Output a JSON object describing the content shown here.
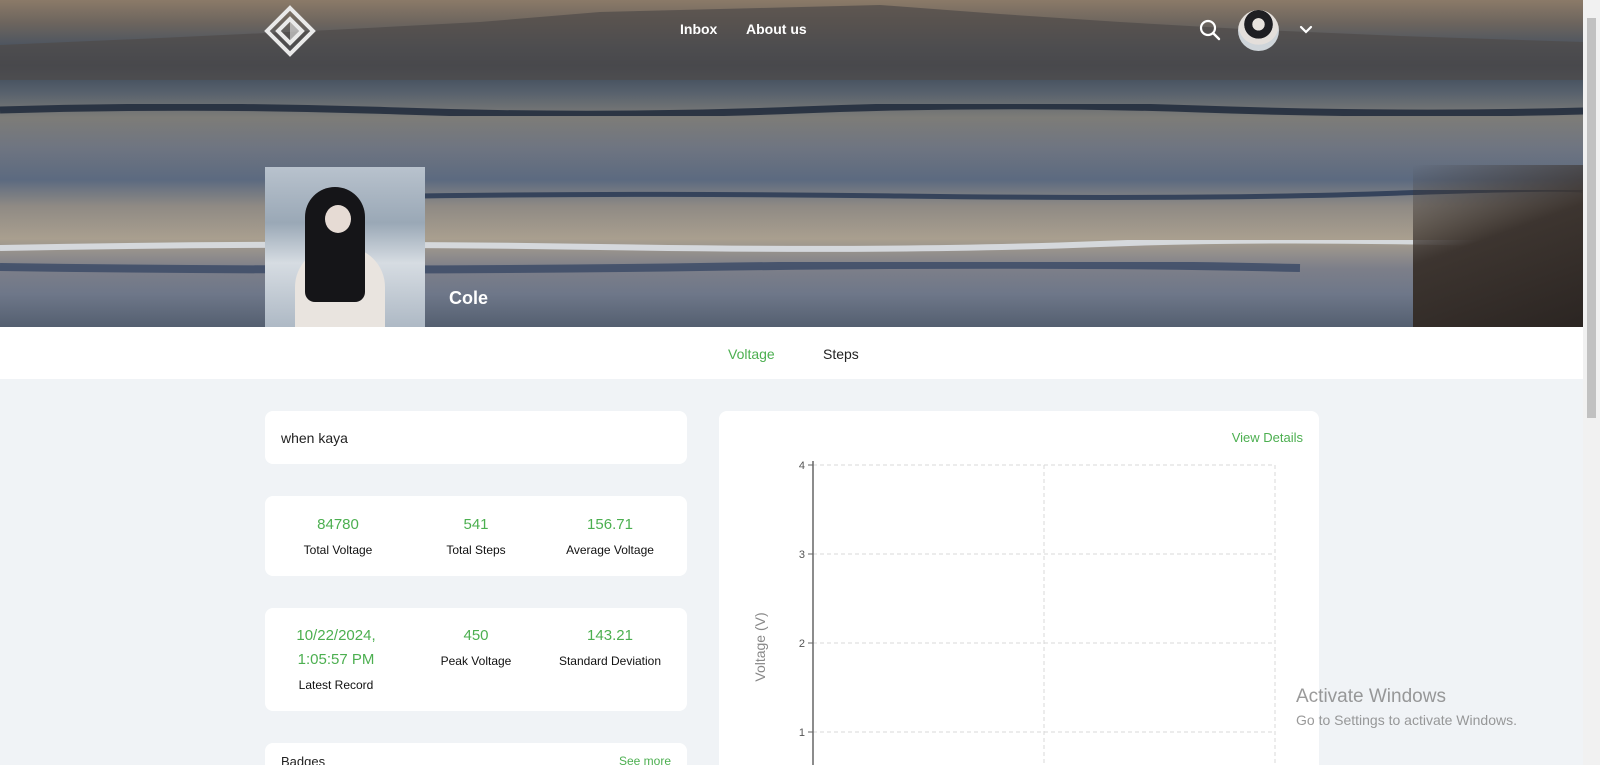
{
  "nav": {
    "links": [
      "Inbox",
      "About us"
    ]
  },
  "profile": {
    "name": "Cole"
  },
  "tabs": [
    "Voltage",
    "Steps"
  ],
  "bio": "when kaya",
  "stats_row1": [
    {
      "value": "84780",
      "label": "Total Voltage"
    },
    {
      "value": "541",
      "label": "Total Steps"
    },
    {
      "value": "156.71",
      "label": "Average Voltage"
    }
  ],
  "stats_row2": [
    {
      "value": "10/22/2024, 1:05:57 PM",
      "label": "Latest Record"
    },
    {
      "value": "450",
      "label": "Peak Voltage"
    },
    {
      "value": "143.21",
      "label": "Standard Deviation"
    }
  ],
  "badges": {
    "title": "Badges",
    "see_more": "See more"
  },
  "chart_panel": {
    "view_details": "View Details"
  },
  "chart_data": {
    "type": "line",
    "title": "",
    "xlabel": "",
    "ylabel": "Voltage (V)",
    "ylim": [
      0,
      4
    ],
    "yticks": [
      "1",
      "2",
      "3",
      "4"
    ],
    "grid": true,
    "series": []
  },
  "watermark": {
    "line1": "Activate Windows",
    "line2": "Go to Settings to activate Windows."
  },
  "colors": {
    "accent": "#4caf50",
    "page_bg": "#f0f3f6"
  }
}
